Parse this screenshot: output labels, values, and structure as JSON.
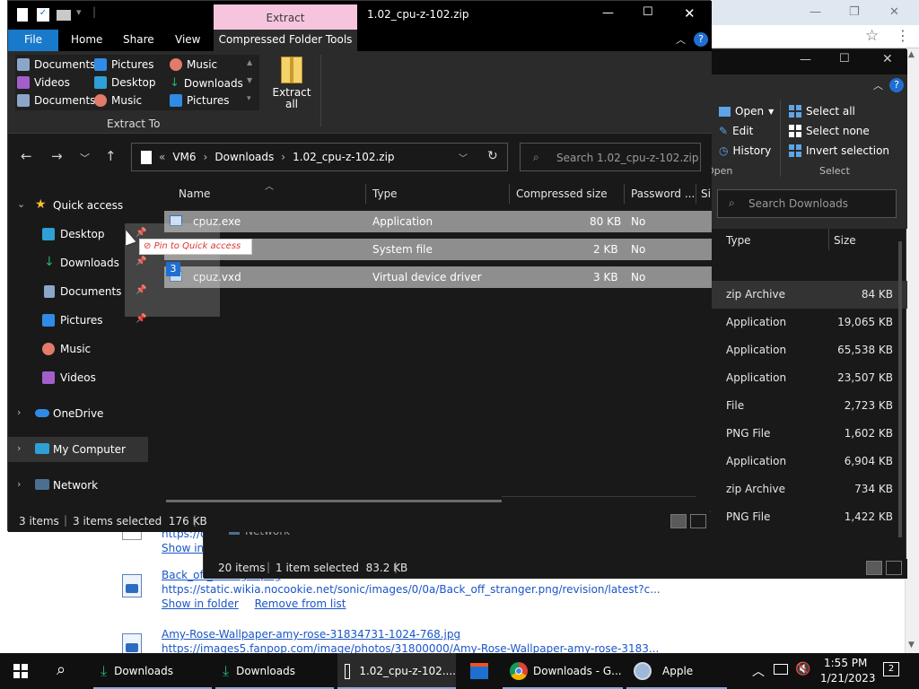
{
  "browser": {
    "controls": {
      "minimize": "—",
      "restore": "❐",
      "close": "✕"
    },
    "downloads": [
      {
        "name": "Back_off_stranger.png",
        "url": "https://static.wikia.nocookie.net/sonic/images/0/0a/Back_off_stranger.png/revision/latest?c...",
        "show": "Show in folder",
        "remove": "Remove from list"
      },
      {
        "name": "Amy-Rose-Wallpaper-amy-rose-31834731-1024-768.jpg",
        "url": "https://images5.fanpop.com/image/photos/31800000/Amy-Rose-Wallpaper-amy-rose-3183..."
      }
    ],
    "partial_url": "https://c...",
    "partial_show": "Show in..."
  },
  "window2": {
    "ribbon": {
      "open": "Open",
      "edit": "Edit",
      "history": "History",
      "open_group": "Open",
      "select_all": "Select all",
      "select_none": "Select none",
      "invert_selection": "Invert selection",
      "select_group": "Select"
    },
    "search_placeholder": "Search Downloads",
    "columns": {
      "type": "Type",
      "size": "Size"
    },
    "rows": [
      {
        "type": "zip Archive",
        "size": "84 KB"
      },
      {
        "type": "Application",
        "size": "19,065 KB"
      },
      {
        "type": "Application",
        "size": "65,538 KB"
      },
      {
        "type": "Application",
        "size": "23,507 KB"
      },
      {
        "type": "File",
        "size": "2,723 KB"
      },
      {
        "type": "PNG File",
        "size": "1,602 KB"
      },
      {
        "type": "Application",
        "size": "6,904 KB"
      },
      {
        "type": "zip Archive",
        "size": "734 KB"
      },
      {
        "type": "PNG File",
        "size": "1,422 KB"
      }
    ],
    "status": {
      "items": "20 items",
      "selected": "1 item selected  83.2 KB"
    }
  },
  "window1": {
    "title": "1.02_cpu-z-102.zip",
    "extract_tab": "Extract",
    "tabs": {
      "file": "File",
      "home": "Home",
      "share": "Share",
      "view": "View",
      "tools": "Compressed Folder Tools"
    },
    "gallery": [
      {
        "label": "Documents",
        "icon": "documents-icon"
      },
      {
        "label": "Pictures",
        "icon": "pictures-icon"
      },
      {
        "label": "Music",
        "icon": "music-icon"
      },
      {
        "label": "Videos",
        "icon": "videos-icon"
      },
      {
        "label": "Desktop",
        "icon": "desktop-icon"
      },
      {
        "label": "Downloads",
        "icon": "downloads-icon"
      },
      {
        "label": "Documents",
        "icon": "documents-icon"
      },
      {
        "label": "Music",
        "icon": "music-icon"
      },
      {
        "label": "Pictures",
        "icon": "pictures-icon"
      }
    ],
    "extract_all_1": "Extract",
    "extract_all_2": "all",
    "extract_to": "Extract To",
    "address": {
      "prefix": "«",
      "seg1": "VM6",
      "seg2": "Downloads",
      "seg3": "1.02_cpu-z-102.zip"
    },
    "search_placeholder": "Search 1.02_cpu-z-102.zip",
    "nav": {
      "quick_access": "Quick access",
      "desktop": "Desktop",
      "downloads": "Downloads",
      "documents": "Documents",
      "pictures": "Pictures",
      "music": "Music",
      "videos": "Videos",
      "onedrive": "OneDrive",
      "my_computer": "My Computer",
      "network": "Network"
    },
    "columns": {
      "name": "Name",
      "type": "Type",
      "compressed": "Compressed size",
      "password": "Password ...",
      "size_partial": "Si"
    },
    "files": [
      {
        "name": "cpuz.exe",
        "type": "Application",
        "size": "80 KB",
        "password": "No"
      },
      {
        "name": "",
        "type": "System file",
        "size": "2 KB",
        "password": "No"
      },
      {
        "name": "cpuz.vxd",
        "type": "Virtual device driver",
        "size": "3 KB",
        "password": "No"
      }
    ],
    "drag_tooltip": "Pin to Quick access",
    "drag_count": "3",
    "status": {
      "items": "3 items",
      "selected": "3 items selected  176 KB"
    }
  },
  "behind_network": "Network",
  "taskbar": {
    "items": [
      {
        "label": "Downloads",
        "icon": "download-folder-icon"
      },
      {
        "label": "Downloads",
        "icon": "download-folder-icon"
      },
      {
        "label": "1.02_cpu-z-102....",
        "icon": "file-icon"
      },
      {
        "label": "",
        "icon": "store-icon"
      },
      {
        "label": "Downloads - G...",
        "icon": "chrome-icon"
      },
      {
        "label": "Apple",
        "icon": "safari-icon"
      }
    ],
    "time": "1:55 PM",
    "date": "1/21/2023",
    "notifications": "2"
  }
}
